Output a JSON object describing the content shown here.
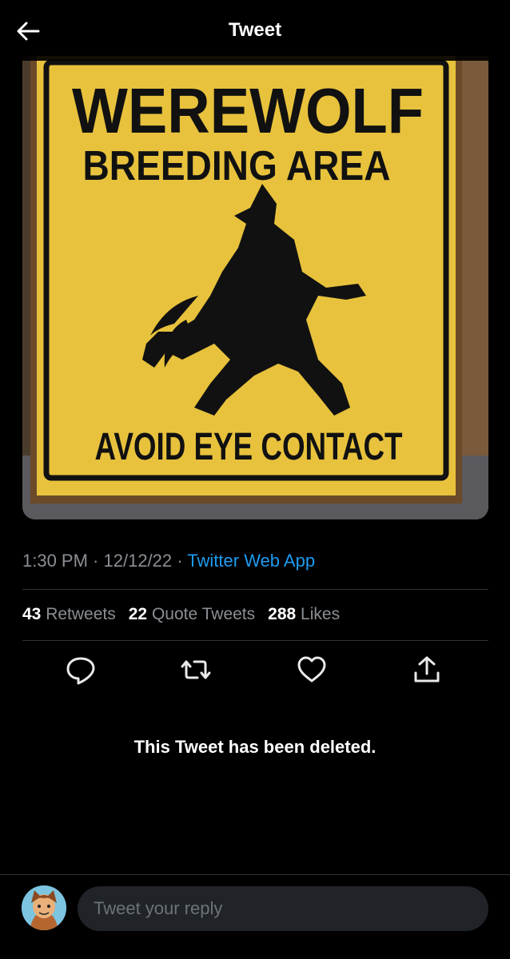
{
  "header": {
    "title": "Tweet"
  },
  "sign": {
    "line1": "WEREWOLF",
    "line2": "BREEDING AREA",
    "line3": "AVOID EYE CONTACT"
  },
  "meta": {
    "time": "1:30 PM",
    "sep1": " · ",
    "date": "12/12/22",
    "sep2": " · ",
    "app": "Twitter Web App"
  },
  "stats": {
    "retweets_count": "43",
    "retweets_label": "Retweets",
    "quotes_count": "22",
    "quotes_label": "Quote Tweets",
    "likes_count": "288",
    "likes_label": "Likes"
  },
  "actions": [
    "reply-icon",
    "retweet-icon",
    "like-icon",
    "share-icon"
  ],
  "deleted_notice": "This Tweet has been deleted.",
  "reply_box": {
    "placeholder": "Tweet your reply"
  },
  "colors": {
    "background": "#000000",
    "accent": "#1d9bf0",
    "sign_yellow": "#e8c23c"
  }
}
